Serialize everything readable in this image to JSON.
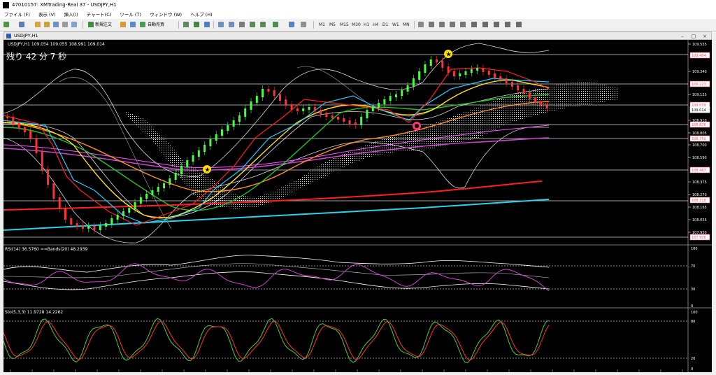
{
  "window": {
    "title": "47010157: XMTrading-Real 37 - USDJPY,H1"
  },
  "menu": [
    "ファイル (F)",
    "表示 (V)",
    "挿入(I)",
    "チャート(C)",
    "ツール (T)",
    "ウィンドウ (W)",
    "ヘルプ (H)"
  ],
  "toolbar": {
    "new_order": "新規注文",
    "auto_trade": "自動売買",
    "timeframes": [
      "M1",
      "M5",
      "M15",
      "M30",
      "H1",
      "H4",
      "D1",
      "W1",
      "MN"
    ]
  },
  "chart_window": {
    "title": "USDJPY,H1"
  },
  "main_panel": {
    "header": "USDJPY,H1  109.054 109.055 108.991 109.014",
    "countdown": "残り 42 分 7 秒",
    "price_ticks": [
      "109.555",
      "109.340",
      "109.125",
      "108.910",
      "108.805",
      "108.700",
      "108.590",
      "108.375",
      "108.270",
      "108.165",
      "108.055",
      "107.950"
    ],
    "level_labels": [
      {
        "text": "109.464",
        "color": "#f05a6a"
      },
      {
        "text": "109.223",
        "color": "#f05a6a"
      },
      {
        "text": "109.039",
        "color": "#f05a6a"
      },
      {
        "text": "109.014",
        "color": "#ffffff"
      },
      {
        "text": "108.876",
        "color": "#f05a6a"
      },
      {
        "text": "108.750",
        "color": "#f05a6a"
      },
      {
        "text": "108.487",
        "color": "#f05a6a"
      },
      {
        "text": "108.218",
        "color": "#f05a6a"
      },
      {
        "text": "107.906",
        "color": "#f05a6a"
      }
    ]
  },
  "rsi_panel": {
    "header": "RSI(14) 36.5760  ==Bands(20) 48.2939",
    "ticks": [
      "100",
      "70",
      "30",
      "0"
    ]
  },
  "sto_panel": {
    "header": "Sto(5,3,3) 11.9728 14.2262",
    "ticks": [
      "100",
      "80",
      "20",
      "0"
    ]
  },
  "colors": {
    "background": "#000000",
    "bull": "#44ff44",
    "bear": "#ff3333",
    "grid": "#ffffff",
    "level_label": "#f05a6a"
  }
}
